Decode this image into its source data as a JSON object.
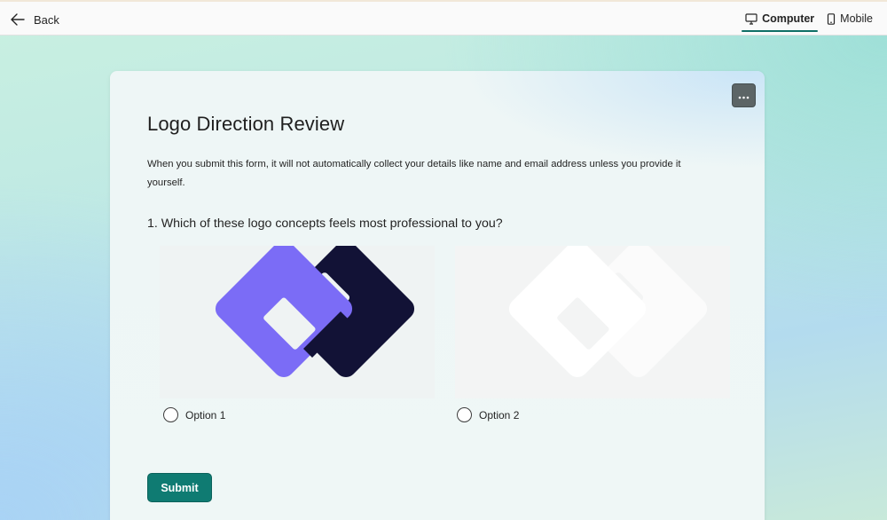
{
  "topbar": {
    "back_label": "Back",
    "tabs": [
      {
        "label": "Computer",
        "icon": "monitor-icon",
        "active": true
      },
      {
        "label": "Mobile",
        "icon": "phone-icon",
        "active": false
      }
    ],
    "accent": "#0f6f66"
  },
  "form": {
    "title": "Logo Direction Review",
    "description": "When you submit this form, it will not automatically collect your details like name and email address unless you provide it yourself.",
    "more_icon": "ellipsis-icon",
    "question": {
      "number": "1.",
      "text": "1. Which of these logo concepts feels most professional to you?",
      "options": [
        {
          "label": "Option 1",
          "selected": false,
          "image": "purple-and-navy-interlocking-logo"
        },
        {
          "label": "Option 2",
          "selected": false,
          "image": "white-interlocking-logo"
        }
      ]
    },
    "submit_label": "Submit",
    "colors": {
      "submit": "#0f7b72",
      "logo_purple": "#7b6cf6",
      "logo_navy": "#121236"
    }
  }
}
